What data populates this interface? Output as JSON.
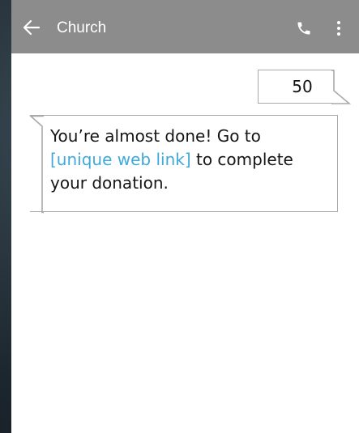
{
  "app_bar": {
    "title": "Church",
    "back_icon": "arrow-left-icon",
    "call_icon": "phone-icon",
    "menu_icon": "more-vertical-icon",
    "background": "#8c8c8c"
  },
  "conversation": {
    "messages": [
      {
        "direction": "sent",
        "text": "50"
      },
      {
        "direction": "received",
        "text_before": "You’re almost done! Go to ",
        "link_text": "[unique web link]",
        "text_after": " to complete your donation."
      }
    ]
  },
  "colors": {
    "link": "#3fa9dc",
    "bubble_border": "#a9a9a9"
  }
}
